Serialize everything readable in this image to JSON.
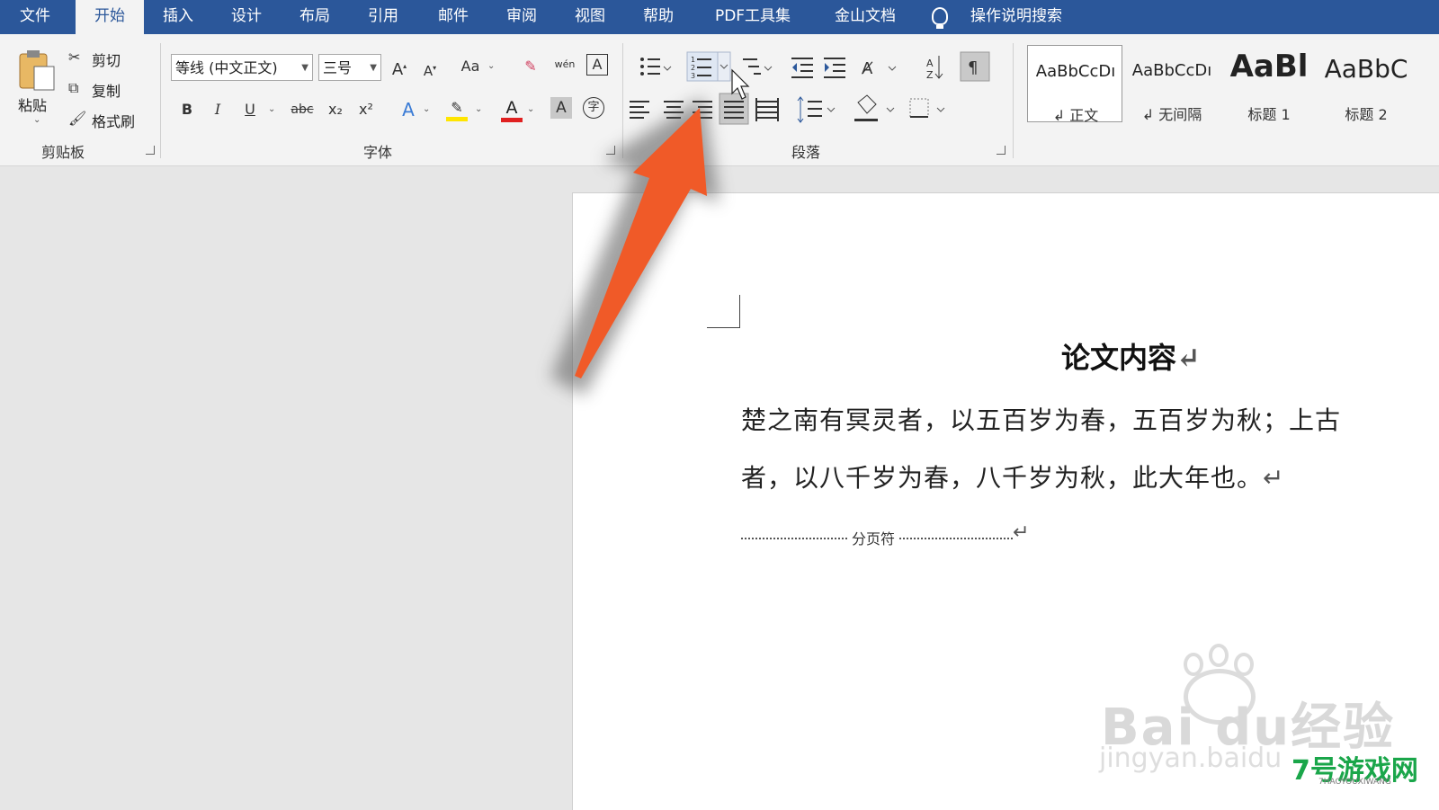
{
  "menu_tabs": [
    "文件",
    "开始",
    "插入",
    "设计",
    "布局",
    "引用",
    "邮件",
    "审阅",
    "视图",
    "帮助",
    "PDF工具集",
    "金山文档",
    "操作说明搜索"
  ],
  "clipboard": {
    "paste": "粘贴",
    "cut": "剪切",
    "copy": "复制",
    "format_painter": "格式刷",
    "group_label": "剪贴板"
  },
  "font": {
    "font_name": "等线 (中文正文)",
    "font_size": "三号",
    "change_case": "Aa",
    "group_label": "字体",
    "bold": "B",
    "italic": "I",
    "underline": "U",
    "strike": "abc",
    "subscript": "x₂",
    "superscript": "x²",
    "text_effect": "A",
    "font_color": "A",
    "char_shading": "A",
    "enclose": "字",
    "phonetic": "wén",
    "char_border": "A"
  },
  "paragraph": {
    "group_label": "段落"
  },
  "styles": [
    {
      "preview": "AaBbCcDı",
      "name": "↲ 正文"
    },
    {
      "preview": "AaBbCcDı",
      "name": "↲ 无间隔"
    },
    {
      "preview": "AaBl",
      "name": "标题 1"
    },
    {
      "preview": "AaBbC",
      "name": "标题 2"
    }
  ],
  "document": {
    "title": "论文内容",
    "lines": [
      "楚之南有冥灵者，以五百岁为春，五百岁为秋；上古",
      "者，以八千岁为春，八千岁为秋，此大年也。"
    ],
    "page_break": "分页符",
    "return_mark": "↵"
  },
  "watermark": {
    "main": "Bai du经验",
    "sub": "jingyan.baidu",
    "logo": "7号游戏网",
    "logo_sub": "7HAOYOUXIWANG"
  },
  "colors": {
    "menubar": "#2b579a",
    "arrow": "#f05a28",
    "font_color_bar": "#e02020",
    "highlight_bar": "#ffe500"
  }
}
